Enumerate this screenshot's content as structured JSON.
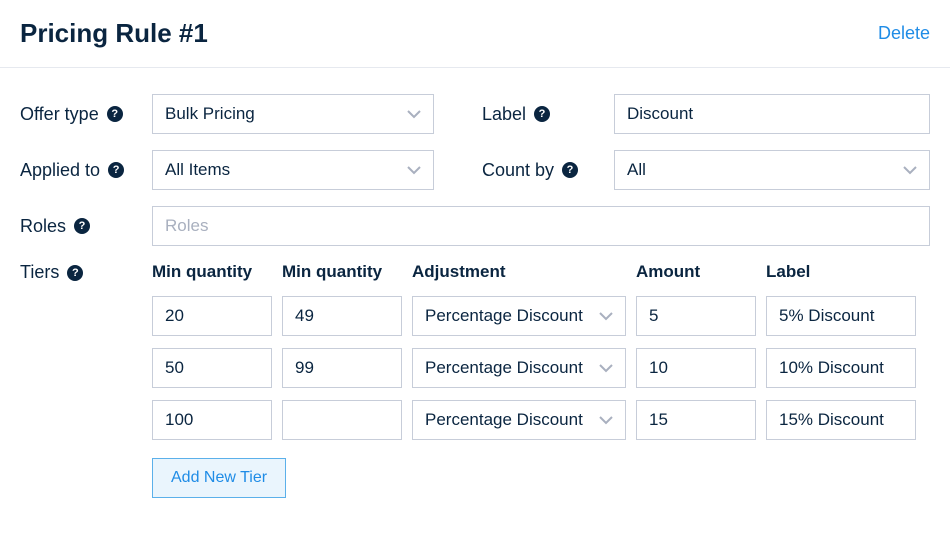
{
  "header": {
    "title": "Pricing Rule #1",
    "delete": "Delete"
  },
  "fields": {
    "offer_type": {
      "label": "Offer type",
      "value": "Bulk Pricing"
    },
    "rule_label": {
      "label": "Label",
      "value": "Discount"
    },
    "applied_to": {
      "label": "Applied to",
      "value": "All Items"
    },
    "count_by": {
      "label": "Count by",
      "value": "All"
    },
    "roles": {
      "label": "Roles",
      "placeholder": "Roles"
    }
  },
  "tiers": {
    "label": "Tiers",
    "columns": {
      "min1": "Min quantity",
      "min2": "Min quantity",
      "adjustment": "Adjustment",
      "amount": "Amount",
      "label": "Label"
    },
    "rows": [
      {
        "min1": "20",
        "min2": "49",
        "adjustment": "Percentage Discount",
        "amount": "5",
        "label": "5% Discount"
      },
      {
        "min1": "50",
        "min2": "99",
        "adjustment": "Percentage Discount",
        "amount": "10",
        "label": "10% Discount"
      },
      {
        "min1": "100",
        "min2": "",
        "adjustment": "Percentage Discount",
        "amount": "15",
        "label": "15% Discount"
      }
    ],
    "add_button": "Add New Tier"
  }
}
